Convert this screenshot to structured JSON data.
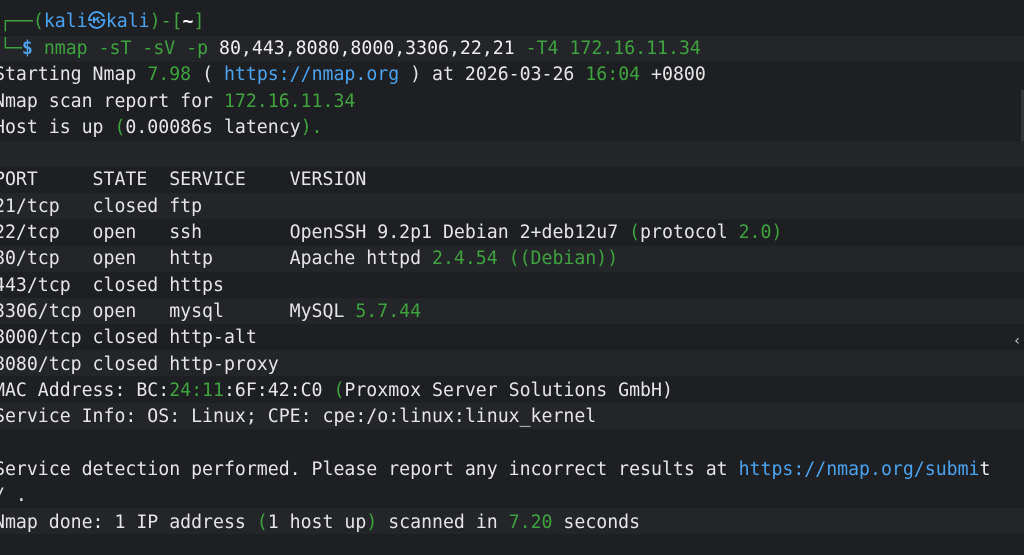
{
  "prompt": {
    "frame_top": "┌──(",
    "user_host_1": "kali",
    "at_symbol": "㉿",
    "user_host_2": "kali",
    "close_bracket": ")-[",
    "path": "~",
    "path_close": "]",
    "frame_bottom": "└─",
    "dollar": "$",
    "command": "nmap",
    "args": "-sT -sV -p",
    "ports_arg": "80,443,8080,8000,3306,22,21",
    "timing_arg": "-T4",
    "target": "172.16.11.34"
  },
  "output": {
    "starting_a": "Starting Nmap ",
    "starting_version": "7.98",
    "starting_b": " ( ",
    "starting_url": "https://nmap.org",
    "starting_c": " ) at 2026-03-26 ",
    "starting_time": "16:04",
    "starting_tz": " +0800",
    "report_a": "Nmap scan report for ",
    "report_ip": "172.16.11.34",
    "hostup_a": "Host is up ",
    "hostup_paren_open": "(",
    "hostup_latency": "0.00086s latency",
    "hostup_paren_close": ").",
    "table_header": "PORT     STATE  SERVICE    VERSION",
    "rows": [
      {
        "text_a": "21/tcp   closed ftp",
        "ver": "",
        "ver_num": "",
        "ver_tail": ""
      },
      {
        "text_a": "22/tcp   open   ssh        OpenSSH 9.2p1 Debian 2+deb12u7 ",
        "ver": "(protocol ",
        "ver_num": "2.0",
        "ver_tail": ")"
      },
      {
        "text_a": "80/tcp   open   http       Apache httpd ",
        "ver": "2.4.54",
        "ver_num": " ((Debian))",
        "ver_tail": ""
      },
      {
        "text_a": "443/tcp  closed https",
        "ver": "",
        "ver_num": "",
        "ver_tail": ""
      },
      {
        "text_a": "3306/tcp open   mysql      MySQL ",
        "ver": "5.7.44",
        "ver_num": "",
        "ver_tail": ""
      },
      {
        "text_a": "8000/tcp closed http-alt",
        "ver": "",
        "ver_num": "",
        "ver_tail": ""
      },
      {
        "text_a": "8080/tcp closed http-proxy",
        "ver": "",
        "ver_num": "",
        "ver_tail": ""
      }
    ],
    "mac_a": "MAC Address: BC:",
    "mac_g": "24:11",
    "mac_b": ":6F:42:C0 ",
    "mac_vendor": "(Proxmox Server Solutions GmbH)",
    "service_info": "Service Info: OS: Linux; CPE: cpe:/o:linux:linux_kernel",
    "detect_a": "Service detection performed. Please report any incorrect results at ",
    "detect_url": "https://nmap.org/submi",
    "detect_url_cont": "t",
    "detect_wrap": "/ .",
    "done_a": "Nmap done: 1 IP address ",
    "done_b": "(1 host up)",
    "done_c": " scanned in ",
    "done_secs": "7.20",
    "done_d": " seconds"
  },
  "scroll_glyph": "‹",
  "colors": {
    "background": "#1e1f22",
    "green": "#3ea33e",
    "blue": "#4aa3f0",
    "text": "#e6e6e6"
  }
}
